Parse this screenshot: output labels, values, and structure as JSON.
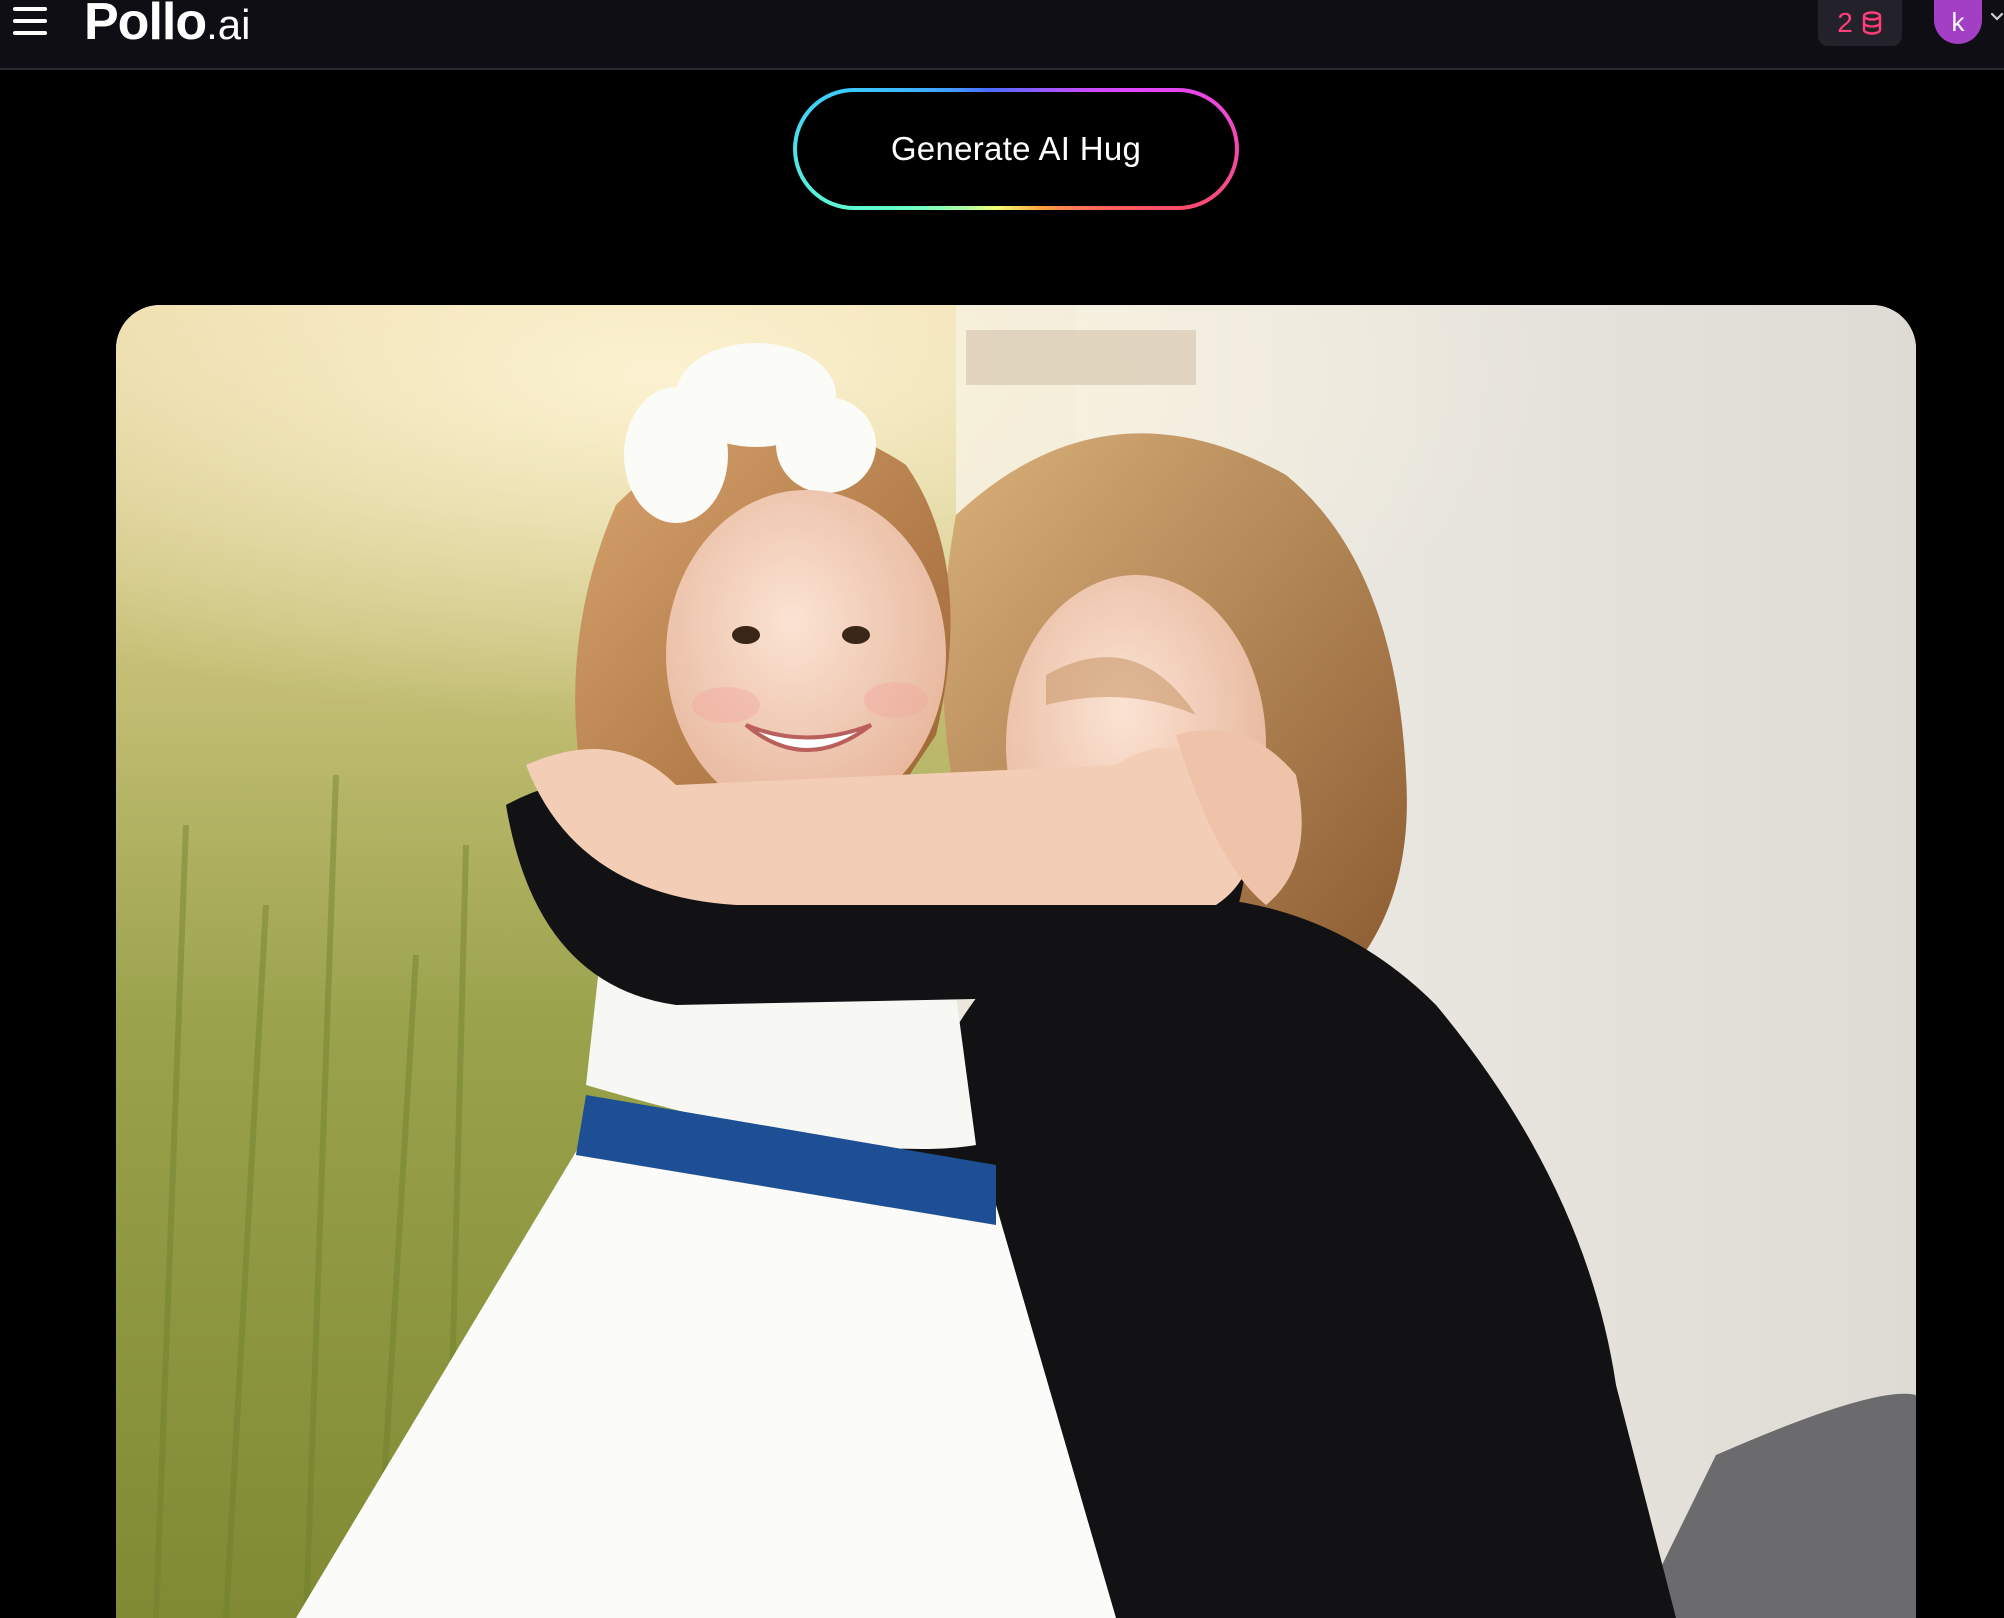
{
  "header": {
    "menu_icon": "hamburger-icon",
    "logo_main": "Pollo",
    "logo_suffix": ".ai",
    "credits": "2",
    "credit_icon": "coin-stack-icon",
    "avatar_initial": "k",
    "avatar_color": "#a33fc5",
    "credit_color": "#ff3d7a"
  },
  "main": {
    "generate_button_label": "Generate AI Hug"
  },
  "media": {
    "photo_icon": "photo-image"
  }
}
